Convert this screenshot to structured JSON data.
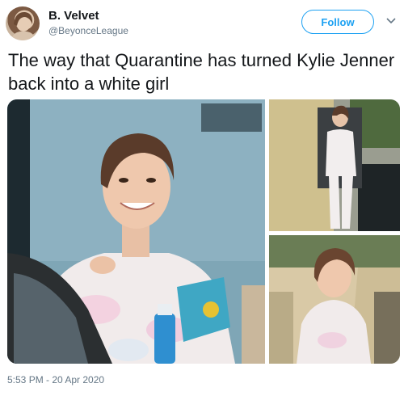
{
  "author": {
    "display_name": "B. Velvet",
    "handle": "@BeyonceLeague"
  },
  "follow_label": "Follow",
  "tweet_text": "The way that Quarantine has turned Kylie Jenner back into a white girl",
  "media": {
    "count": 3
  },
  "timestamp": "5:53 PM - 20 Apr 2020",
  "colors": {
    "accent": "#1da1f2",
    "text": "#14171a",
    "secondary_text": "#657786"
  },
  "icons": {
    "menu": "chevron-down-icon"
  }
}
